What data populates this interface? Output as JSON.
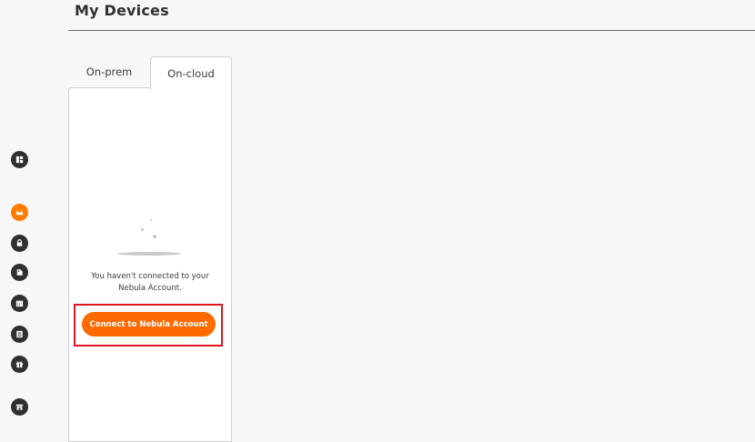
{
  "header": {
    "title": "My Devices"
  },
  "tabs": [
    {
      "label": "On-prem",
      "active": false
    },
    {
      "label": "On-cloud",
      "active": true
    }
  ],
  "sidebar": {
    "items": [
      {
        "icon": "dashboard-icon"
      },
      {
        "icon": "router-icon",
        "active": true
      },
      {
        "icon": "lock-icon"
      },
      {
        "icon": "tag-icon"
      },
      {
        "icon": "calendar-icon"
      },
      {
        "icon": "list-icon"
      },
      {
        "icon": "gift-icon"
      },
      {
        "icon": "store-icon"
      }
    ]
  },
  "empty_state": {
    "message_line1": "You haven't connected to your",
    "message_line2": "Nebula Account.",
    "button_label": "Connect to Nebula Account"
  },
  "colors": {
    "accent": "#ff6a00",
    "active_icon": "#ff7a00",
    "highlight": "#e0141e",
    "icon": "#2f2f2f"
  }
}
